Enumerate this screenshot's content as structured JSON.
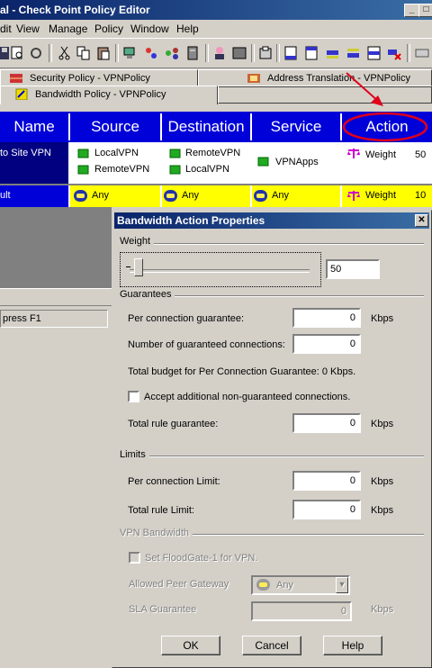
{
  "window": {
    "title": "al - Check Point Policy Editor"
  },
  "menu": [
    "dit",
    "View",
    "Manage",
    "Policy",
    "Window",
    "Help"
  ],
  "tabs": {
    "security": "Security Policy - VPNPolicy",
    "nat": "Address Translation - VPNPolicy",
    "bandwidth": "Bandwidth Policy - VPNPolicy"
  },
  "grid": {
    "headers": [
      "Name",
      "Source",
      "Destination",
      "Service",
      "Action"
    ],
    "rows": [
      {
        "name": "to Site VPN",
        "source": [
          "LocalVPN",
          "RemoteVPN"
        ],
        "destination": [
          "RemoteVPN",
          "LocalVPN"
        ],
        "service": "VPNApps",
        "action": "Weight",
        "weight": "50"
      },
      {
        "name": "ult",
        "source": [
          "Any"
        ],
        "destination": [
          "Any"
        ],
        "service": "Any",
        "action": "Weight",
        "weight": "10"
      }
    ]
  },
  "status": {
    "text": "press F1"
  },
  "dialog": {
    "title": "Bandwidth Action Properties",
    "weight_group": "Weight",
    "weight_value": "50",
    "weight_level": 0.05,
    "guarantees_group": "Guarantees",
    "per_conn_guarantee_label": "Per connection guarantee:",
    "per_conn_guarantee_value": "0",
    "num_guaranteed_label": "Number of guaranteed connections:",
    "num_guaranteed_value": "0",
    "total_budget_text": "Total budget for Per Connection Guarantee: 0 Kbps.",
    "accept_label": "Accept additional non-guaranteed connections.",
    "total_rule_guarantee_label": "Total rule guarantee:",
    "total_rule_guarantee_value": "0",
    "limits_group": "Limits",
    "per_conn_limit_label": "Per connection Limit:",
    "per_conn_limit_value": "0",
    "total_rule_limit_label": "Total rule Limit:",
    "total_rule_limit_value": "0",
    "unit": "Kbps",
    "vpn_group": "VPN Bandwidth",
    "floodgate_label": "Set FloodGate-1 for VPN.",
    "allowed_peer_label": "Allowed Peer Gateway",
    "allowed_peer_value": "Any",
    "sla_label": "SLA Guarantee",
    "sla_value": "0",
    "ok": "OK",
    "cancel": "Cancel",
    "help": "Help"
  },
  "colors": {
    "header_blue": "#0000d8",
    "default_row_yellow": "#ffff00",
    "annotation_red": "#e0001a"
  }
}
